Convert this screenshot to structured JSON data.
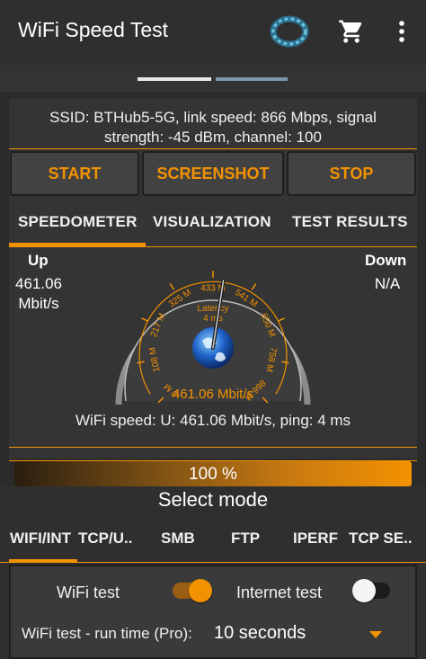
{
  "app": {
    "title": "WiFi Speed Test",
    "accent_color": "#f39200",
    "icons": [
      "ring-logo-icon",
      "cart-icon",
      "overflow-menu-icon"
    ]
  },
  "pager": {
    "pages": 2,
    "active_index": 0
  },
  "info": {
    "line1": "SSID: BTHub5-5G, link speed: 866 Mbps, signal",
    "line2": "strength: -45 dBm, channel: 100"
  },
  "buttons": {
    "start": "START",
    "screenshot": "SCREENSHOT",
    "stop": "STOP"
  },
  "tabs": {
    "speedometer": "SPEEDOMETER",
    "visualization": "VISUALIZATION",
    "test_results": "TEST RESULTS",
    "active": "speedometer"
  },
  "up": {
    "label": "Up",
    "value": "461.06",
    "unit": "Mbit/s"
  },
  "down": {
    "label": "Down",
    "value": "N/A"
  },
  "gauge": {
    "ticks": [
      "0 M",
      "108 M",
      "217 M",
      "325 M",
      "433 M",
      "541 M",
      "650 M",
      "758 M",
      "866 M"
    ],
    "max": 866,
    "value": 461.06,
    "latency_label": "Latency",
    "latency_value": "4 ms",
    "readout": "461.06 Mbit/s"
  },
  "summary": "WiFi speed: U: 461.06 Mbit/s, ping: 4 ms",
  "progress": {
    "percent": 100,
    "text": "100 %"
  },
  "select_mode": "Select mode",
  "mode_tabs": [
    "WIFI/INT",
    "TCP/U..",
    "SMB",
    "FTP",
    "IPERF",
    "TCP SE.."
  ],
  "mode_tab_active": "WIFI/INT",
  "options": {
    "wifi_test": {
      "label": "WiFi test",
      "on": true
    },
    "internet_test": {
      "label": "Internet test",
      "on": false
    }
  },
  "runtime": {
    "label": "WiFi test - run time (Pro):",
    "value": "10 seconds"
  }
}
